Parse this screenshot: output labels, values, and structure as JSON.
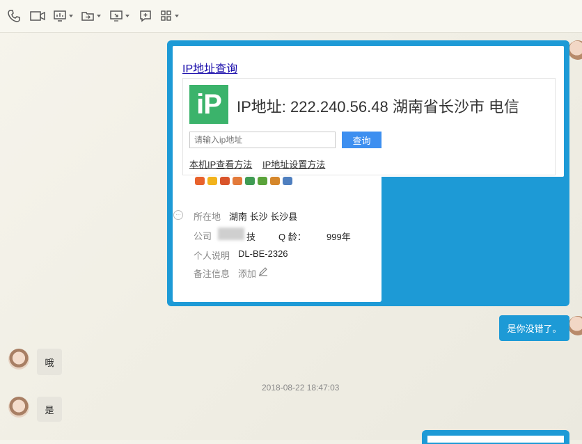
{
  "toolbar": {
    "icons": [
      "phone-icon",
      "video-icon",
      "screen-share-icon",
      "file-transfer-icon",
      "remote-desktop-icon",
      "add-icon",
      "apps-icon"
    ]
  },
  "ip_lookup": {
    "title": "IP地址查询",
    "logo_text": "iP",
    "address_label": "IP地址: 222.240.56.48  湖南省长沙市 电信",
    "input_placeholder": "请输入ip地址",
    "query_button": "查询",
    "link_local_ip": "本机IP查看方法",
    "link_ip_settings": "IP地址设置方法"
  },
  "profile": {
    "location_label": "所在地",
    "location_value": "湖南 长沙 长沙县",
    "company_label": "公司",
    "company_value": "技",
    "qq_age_label": "Q    龄：",
    "qq_age_value": "999年",
    "bio_label": "个人说明",
    "bio_value": "DL-BE-2326",
    "note_label": "备注信息",
    "note_value": "添加"
  },
  "messages": {
    "right_1": "是你没错了。",
    "left_1": "哦",
    "timestamp": "2018-08-22 18:47:03",
    "left_2": "是"
  },
  "colors": {
    "accent_blue": "#1d9ad6",
    "ip_green": "#3bb36b",
    "query_button_blue": "#3d8ff0"
  }
}
